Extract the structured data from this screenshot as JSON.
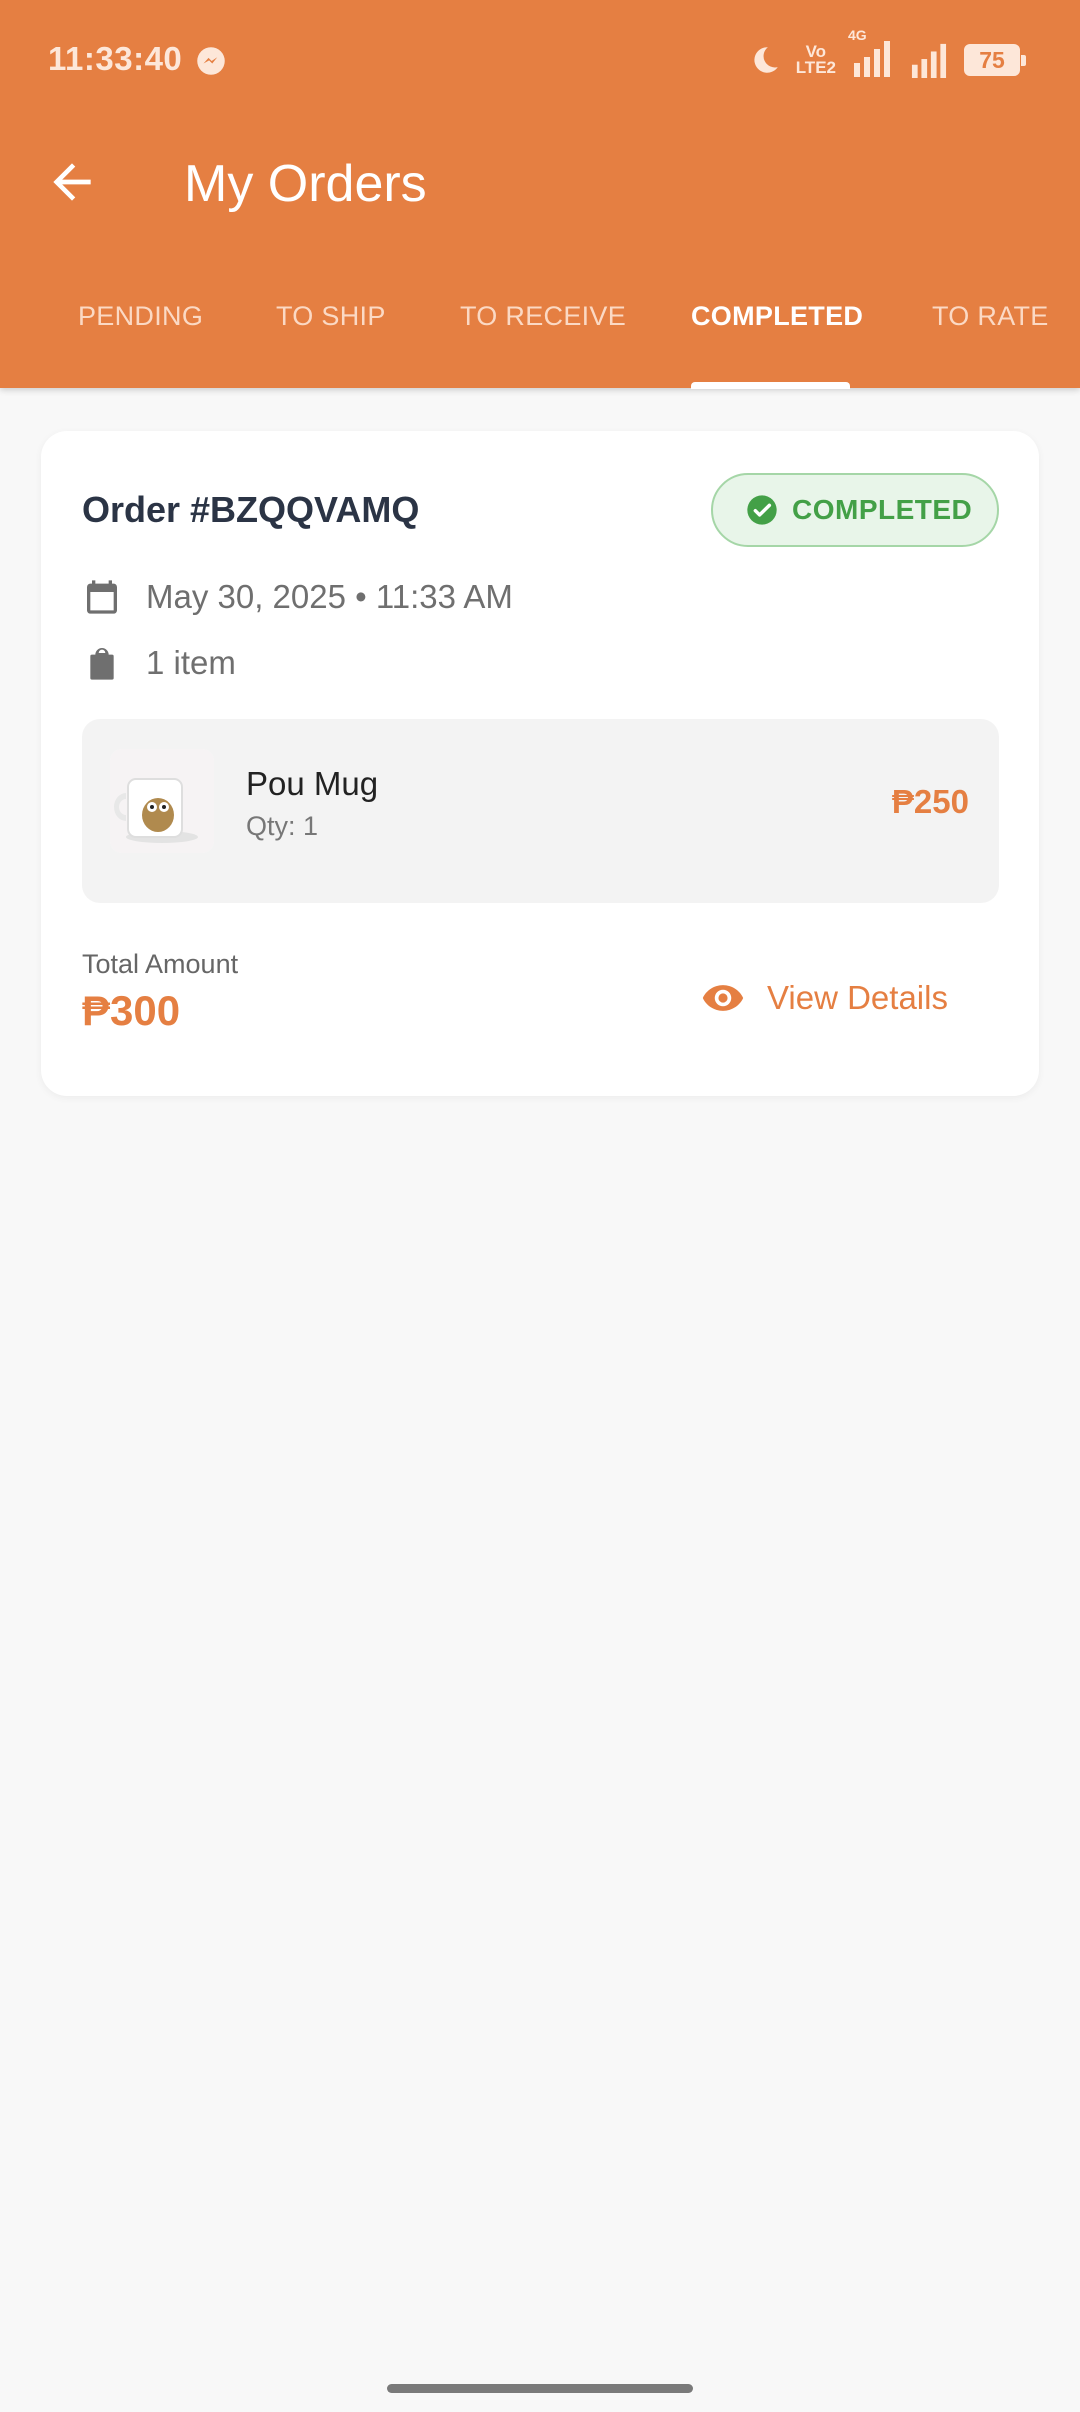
{
  "status_bar": {
    "time": "11:33:40",
    "volte": [
      "Vo",
      "LTE2"
    ],
    "network": "4G",
    "battery": "75"
  },
  "header": {
    "title": "My Orders",
    "back_icon": "arrow-left-icon"
  },
  "tabs": [
    {
      "label": "PENDING",
      "active": false
    },
    {
      "label": "TO SHIP",
      "active": false
    },
    {
      "label": "TO RECEIVE",
      "active": false
    },
    {
      "label": "COMPLETED",
      "active": true
    },
    {
      "label": "TO RATE",
      "active": false
    }
  ],
  "order": {
    "id": "Order #BZQQVAMQ",
    "status": "COMPLETED",
    "date": "May 30, 2025 • 11:33 AM",
    "item_count": "1 item",
    "items": [
      {
        "name": "Pou Mug",
        "qty": "Qty: 1",
        "price": "₱250"
      }
    ],
    "total_label": "Total Amount",
    "total": "₱300",
    "view_details": "View Details"
  },
  "colors": {
    "brand": "#e57f42",
    "success": "#43a047",
    "background": "#f8f8f8"
  }
}
